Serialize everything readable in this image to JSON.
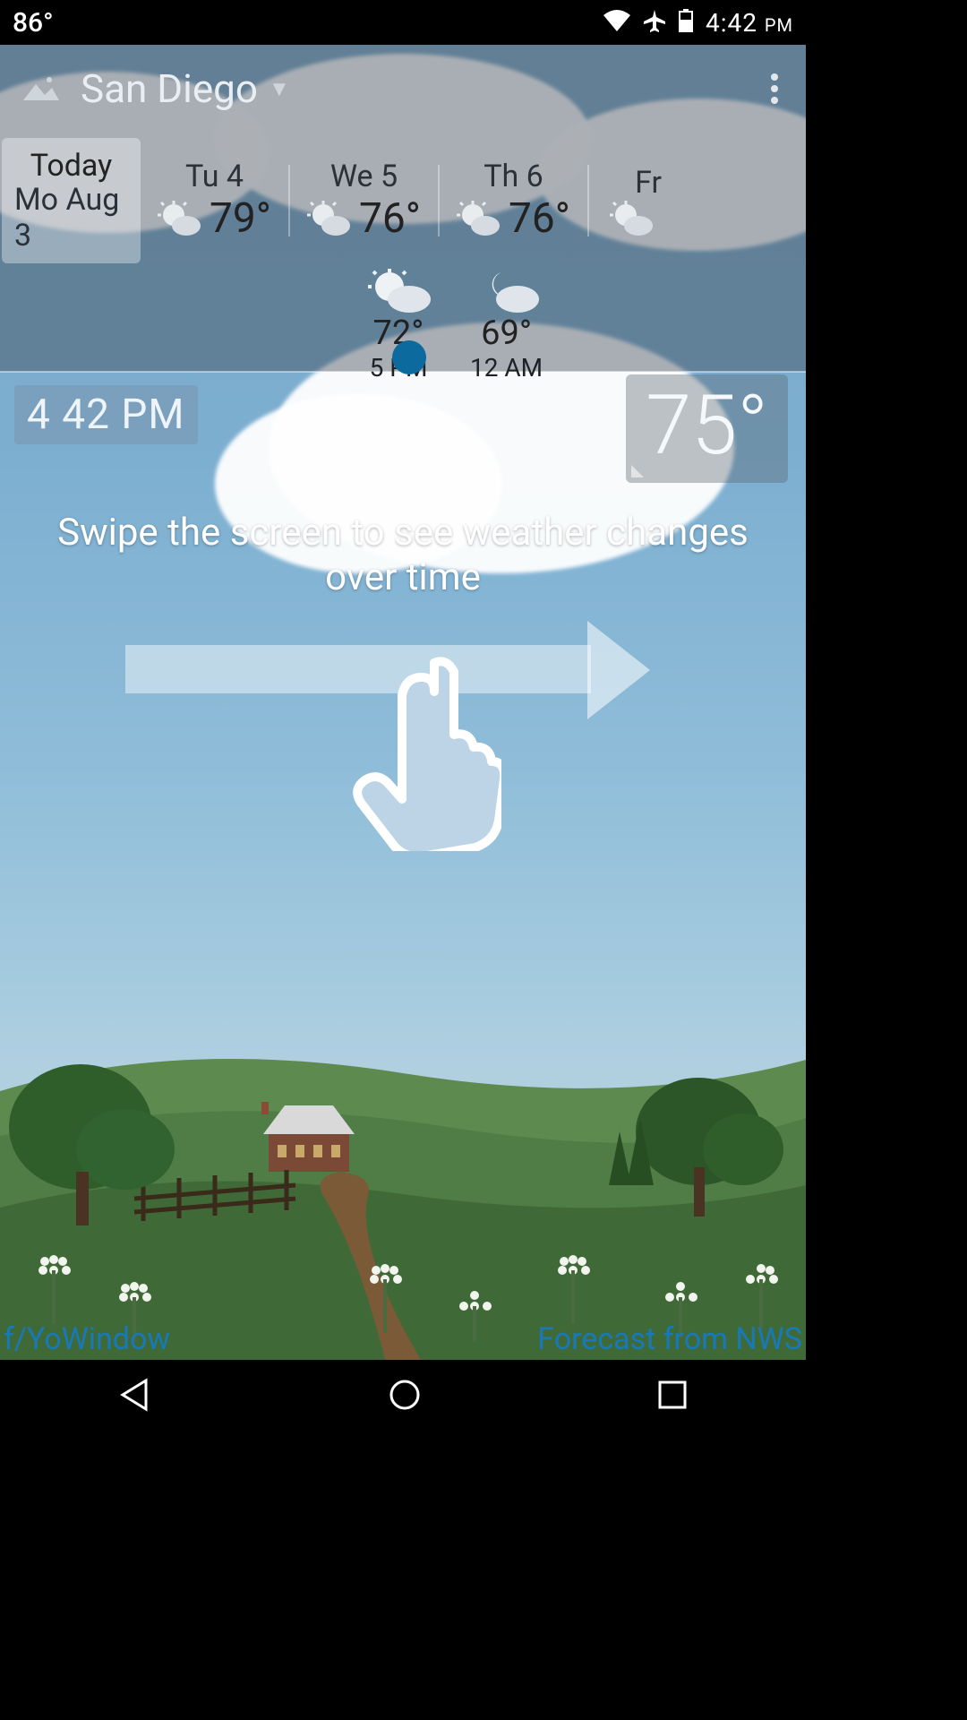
{
  "status": {
    "temp": "86°",
    "time": "4:42",
    "ampm": "PM"
  },
  "header": {
    "location": "San Diego"
  },
  "days": [
    {
      "l1": "Today",
      "l2": "Mo Aug 3",
      "temp": ""
    },
    {
      "l1": "Tu 4",
      "temp": "79°"
    },
    {
      "l1": "We 5",
      "temp": "76°"
    },
    {
      "l1": "Th 6",
      "temp": "76°"
    },
    {
      "l1": "Fr",
      "temp": ""
    }
  ],
  "hours": [
    {
      "temp": "72°",
      "label": "5 PM"
    },
    {
      "temp": "69°",
      "label": "12 AM"
    }
  ],
  "clock": "4  42 PM",
  "current_temp": "75°",
  "tutorial": "Swipe the screen to see weather changes over time",
  "links": {
    "left": "f/YoWindow",
    "right": "Forecast from NWS"
  }
}
